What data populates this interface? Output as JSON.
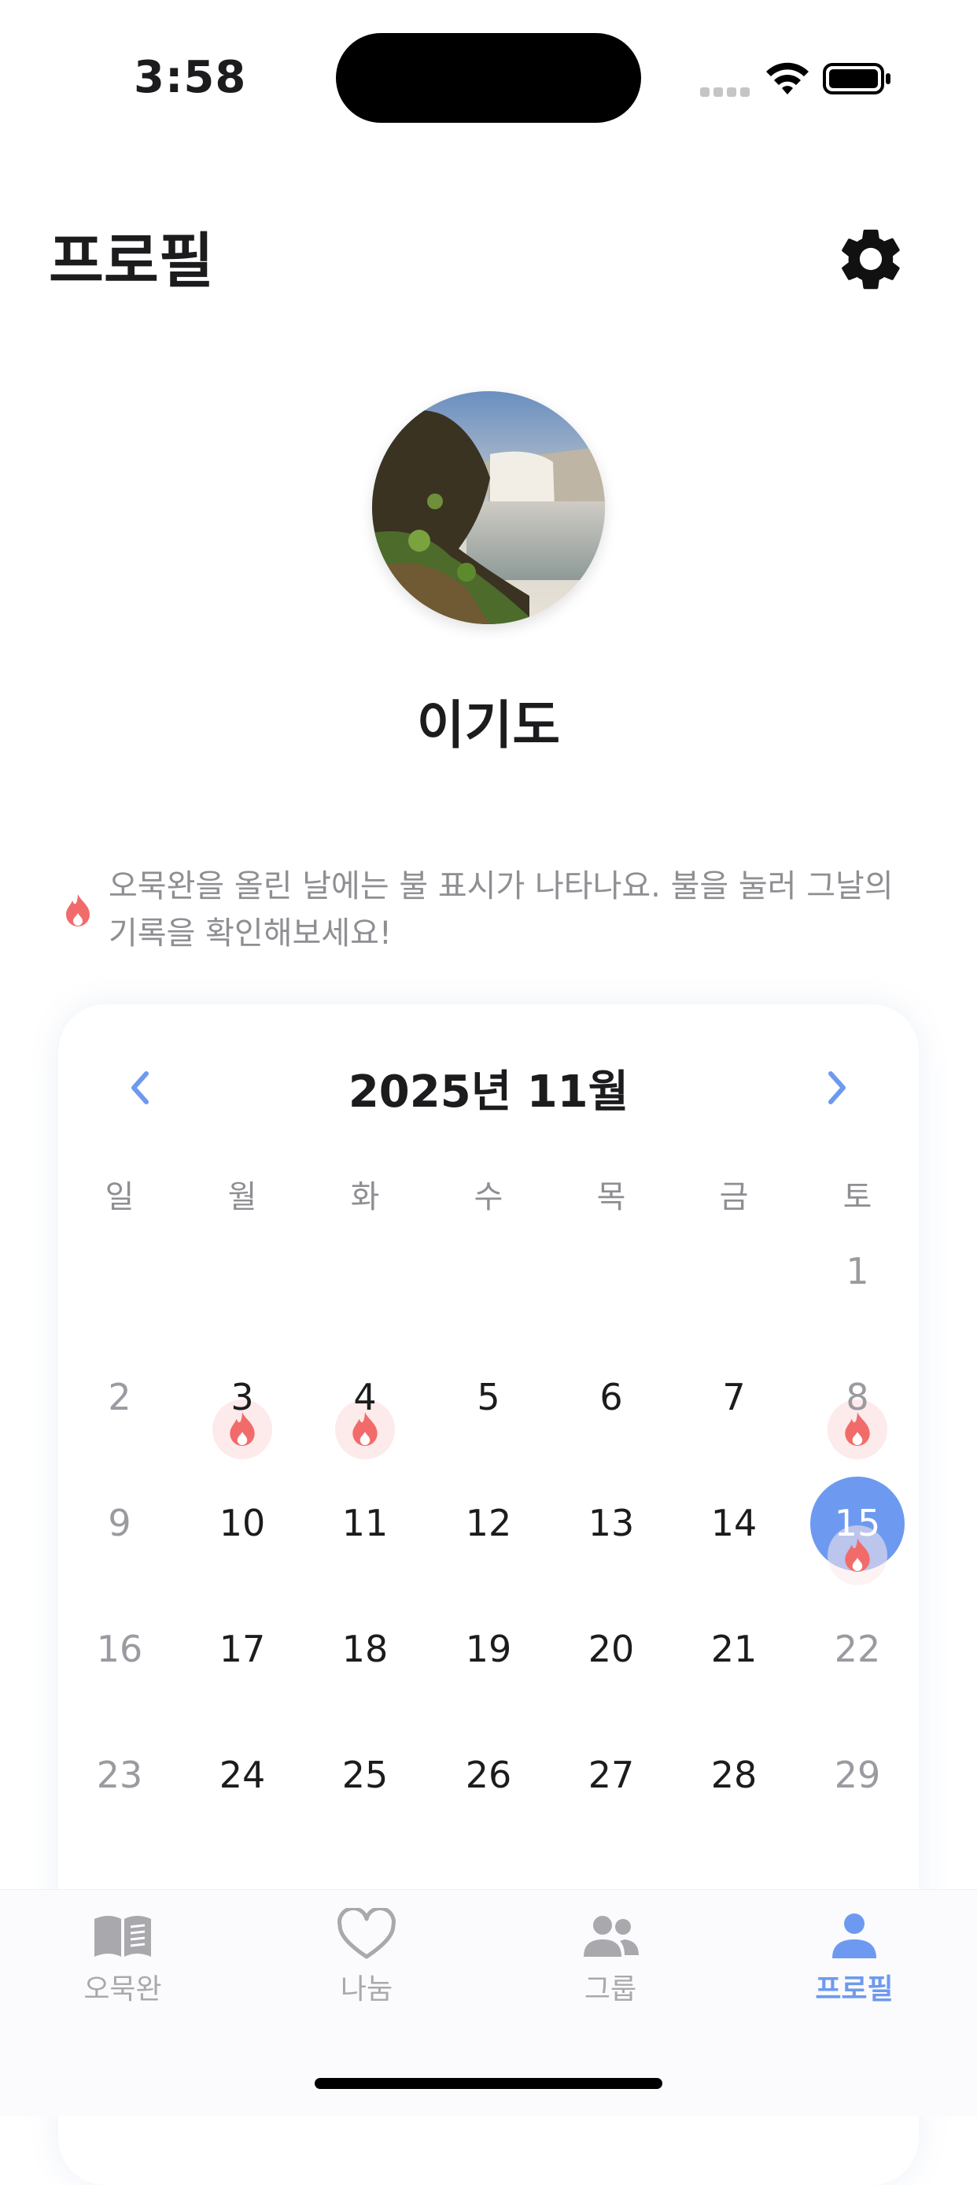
{
  "status_bar": {
    "time": "3:58"
  },
  "header": {
    "title": "프로필",
    "settings_icon": "gear-icon"
  },
  "profile": {
    "name": "이기도",
    "avatar": "waterfall-photo"
  },
  "hint": {
    "text": "오묵완을 올린 날에는 불 표시가 나타나요. 불을 눌러 그날의 기록을 확인해보세요!",
    "icon": "fire-icon"
  },
  "calendar": {
    "title": "2025년 11월",
    "weekdays": [
      "일",
      "월",
      "화",
      "수",
      "목",
      "금",
      "토"
    ],
    "days": [
      "1",
      "2",
      "3",
      "4",
      "5",
      "6",
      "7",
      "8",
      "9",
      "10",
      "11",
      "12",
      "13",
      "14",
      "15",
      "16",
      "17",
      "18",
      "19",
      "20",
      "21",
      "22",
      "23",
      "24",
      "25",
      "26",
      "27",
      "28",
      "29"
    ],
    "selected_day": "15",
    "fire_days": [
      "3",
      "4",
      "8",
      "15"
    ],
    "accent_color": "#6d9af0",
    "fire_color": "#f26b6b"
  },
  "tab_bar": {
    "tabs": [
      {
        "label": "오묵완",
        "icon": "book-icon"
      },
      {
        "label": "나눔",
        "icon": "heart-icon"
      },
      {
        "label": "그룹",
        "icon": "people-icon"
      },
      {
        "label": "프로필",
        "icon": "person-icon"
      }
    ],
    "active": "프로필"
  }
}
